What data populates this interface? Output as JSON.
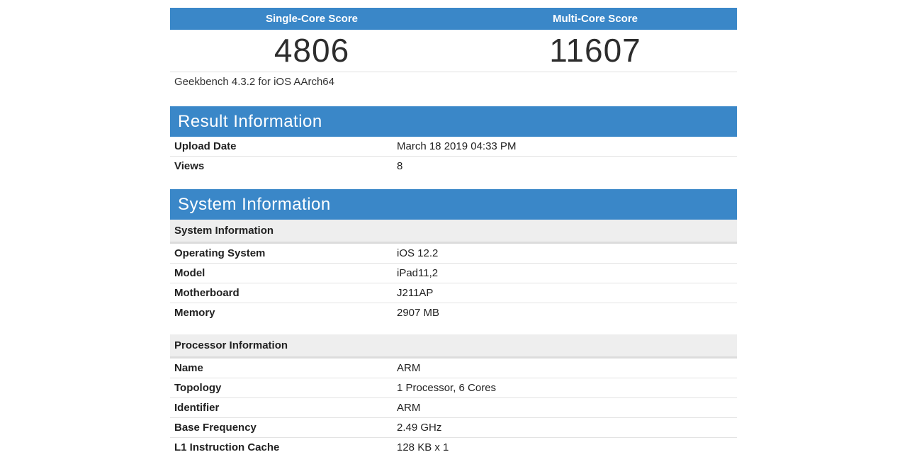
{
  "scores": {
    "single_label": "Single-Core Score",
    "multi_label": "Multi-Core Score",
    "single_value": "4806",
    "multi_value": "11607"
  },
  "version": "Geekbench 4.3.2 for iOS AArch64",
  "result": {
    "title": "Result Information",
    "rows": [
      {
        "key": "Upload Date",
        "value": "March 18 2019 04:33 PM"
      },
      {
        "key": "Views",
        "value": "8"
      }
    ]
  },
  "system": {
    "title": "System Information",
    "subhead": "System Information",
    "rows": [
      {
        "key": "Operating System",
        "value": "iOS 12.2"
      },
      {
        "key": "Model",
        "value": "iPad11,2"
      },
      {
        "key": "Motherboard",
        "value": "J211AP"
      },
      {
        "key": "Memory",
        "value": "2907 MB"
      }
    ]
  },
  "processor": {
    "subhead": "Processor Information",
    "rows": [
      {
        "key": "Name",
        "value": "ARM"
      },
      {
        "key": "Topology",
        "value": "1 Processor, 6 Cores"
      },
      {
        "key": "Identifier",
        "value": "ARM"
      },
      {
        "key": "Base Frequency",
        "value": "2.49 GHz"
      },
      {
        "key": "L1 Instruction Cache",
        "value": "128 KB x 1"
      }
    ]
  },
  "colors": {
    "accent": "#3a87c8",
    "subhead_bg": "#eeeeee"
  }
}
